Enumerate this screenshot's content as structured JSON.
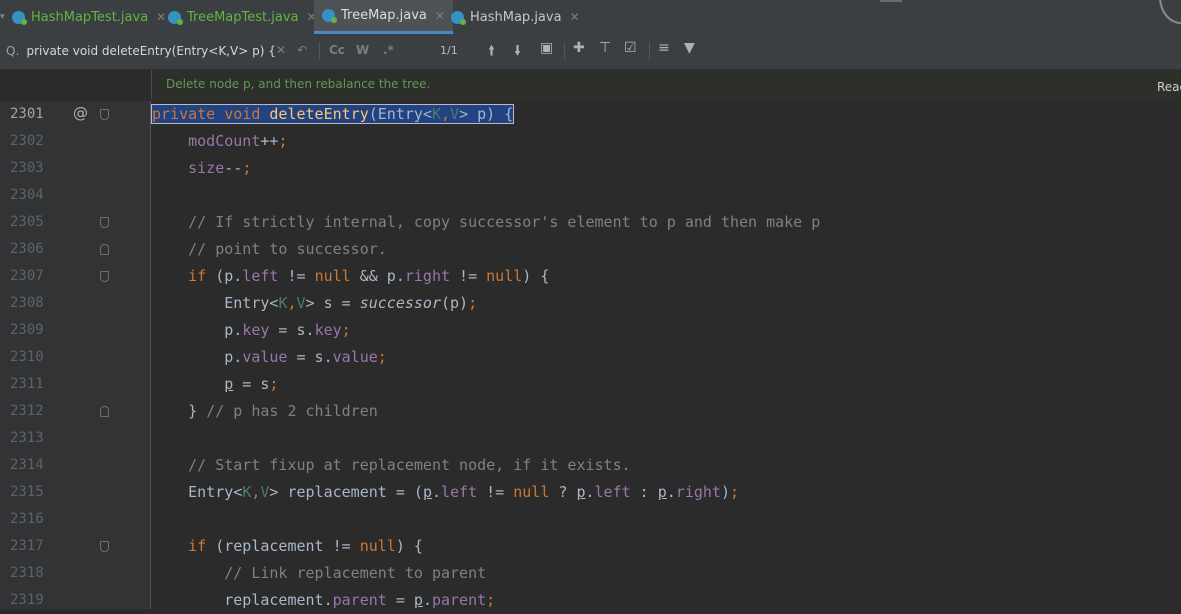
{
  "tabs": [
    {
      "label": "HashMapTest.java",
      "style": "green"
    },
    {
      "label": "TreeMapTest.java",
      "style": "green"
    },
    {
      "label": "TreeMap.java",
      "style": "active"
    },
    {
      "label": "HashMap.java",
      "style": "plain"
    }
  ],
  "search": {
    "query": "private void deleteEntry(Entry<K,V> p) {",
    "case_label": "Cc",
    "word_label": "W",
    "regex_label": ".*",
    "match_count": "1/1"
  },
  "doc_comment": "Delete node p, and then rebalance the tree.",
  "reader_mode_label": "Read",
  "colors": {
    "keyword": "#cc7832",
    "method": "#ffc66d",
    "field": "#9876aa",
    "type_param": "#507874",
    "comment": "#808080",
    "selection": "#214283"
  },
  "lines": [
    {
      "num": "2301",
      "marker": "@",
      "fold": "start",
      "current": true,
      "tokens": [
        {
          "t": "private void ",
          "c": "kw"
        },
        {
          "t": "deleteEntry",
          "c": "fn"
        },
        {
          "t": "(Entry<"
        },
        {
          "t": "K",
          "c": "tp"
        },
        {
          "t": ",",
          "c": "kw"
        },
        {
          "t": "V",
          "c": "tp"
        },
        {
          "t": "> p) {"
        }
      ],
      "selected": true
    },
    {
      "num": "2302",
      "tokens": [
        {
          "t": "    "
        },
        {
          "t": "modCount",
          "c": "fld"
        },
        {
          "t": "++"
        },
        {
          "t": ";",
          "c": "kw"
        }
      ]
    },
    {
      "num": "2303",
      "tokens": [
        {
          "t": "    "
        },
        {
          "t": "size",
          "c": "fld"
        },
        {
          "t": "--"
        },
        {
          "t": ";",
          "c": "kw"
        }
      ]
    },
    {
      "num": "2304",
      "tokens": []
    },
    {
      "num": "2305",
      "fold": "start",
      "tokens": [
        {
          "t": "    "
        },
        {
          "t": "// If strictly internal, copy successor's element to p and then make p",
          "c": "cm"
        }
      ]
    },
    {
      "num": "2306",
      "fold": "end",
      "tokens": [
        {
          "t": "    "
        },
        {
          "t": "// point to successor.",
          "c": "cm"
        }
      ]
    },
    {
      "num": "2307",
      "fold": "start",
      "tokens": [
        {
          "t": "    "
        },
        {
          "t": "if ",
          "c": "kw"
        },
        {
          "t": "(p."
        },
        {
          "t": "left",
          "c": "fld"
        },
        {
          "t": " != "
        },
        {
          "t": "null",
          "c": "kw"
        },
        {
          "t": " && p."
        },
        {
          "t": "right",
          "c": "fld"
        },
        {
          "t": " != "
        },
        {
          "t": "null",
          "c": "kw"
        },
        {
          "t": ") {"
        }
      ]
    },
    {
      "num": "2308",
      "tokens": [
        {
          "t": "        Entry<"
        },
        {
          "t": "K",
          "c": "tp"
        },
        {
          "t": ",",
          "c": "kw"
        },
        {
          "t": "V",
          "c": "tp"
        },
        {
          "t": "> s = "
        },
        {
          "t": "successor",
          "c": "it"
        },
        {
          "t": "(p)"
        },
        {
          "t": ";",
          "c": "kw"
        }
      ]
    },
    {
      "num": "2309",
      "tokens": [
        {
          "t": "        p."
        },
        {
          "t": "key",
          "c": "fld"
        },
        {
          "t": " = s."
        },
        {
          "t": "key",
          "c": "fld"
        },
        {
          "t": ";",
          "c": "kw"
        }
      ]
    },
    {
      "num": "2310",
      "tokens": [
        {
          "t": "        p."
        },
        {
          "t": "value",
          "c": "fld"
        },
        {
          "t": " = s."
        },
        {
          "t": "value",
          "c": "fld"
        },
        {
          "t": ";",
          "c": "kw"
        }
      ]
    },
    {
      "num": "2311",
      "tokens": [
        {
          "t": "        "
        },
        {
          "t": "p",
          "c": "ul"
        },
        {
          "t": " = s"
        },
        {
          "t": ";",
          "c": "kw"
        }
      ]
    },
    {
      "num": "2312",
      "fold": "end",
      "tokens": [
        {
          "t": "    } "
        },
        {
          "t": "// p has 2 children",
          "c": "cm"
        }
      ]
    },
    {
      "num": "2313",
      "tokens": []
    },
    {
      "num": "2314",
      "tokens": [
        {
          "t": "    "
        },
        {
          "t": "// Start fixup at replacement node, if it exists.",
          "c": "cm"
        }
      ]
    },
    {
      "num": "2315",
      "tokens": [
        {
          "t": "    Entry<"
        },
        {
          "t": "K",
          "c": "tp"
        },
        {
          "t": ",",
          "c": "kw"
        },
        {
          "t": "V",
          "c": "tp"
        },
        {
          "t": "> replacement = ("
        },
        {
          "t": "p",
          "c": "ul"
        },
        {
          "t": "."
        },
        {
          "t": "left",
          "c": "fld"
        },
        {
          "t": " != "
        },
        {
          "t": "null",
          "c": "kw"
        },
        {
          "t": " ? "
        },
        {
          "t": "p",
          "c": "ul"
        },
        {
          "t": "."
        },
        {
          "t": "left",
          "c": "fld"
        },
        {
          "t": " : "
        },
        {
          "t": "p",
          "c": "ul"
        },
        {
          "t": "."
        },
        {
          "t": "right",
          "c": "fld"
        },
        {
          "t": ")"
        },
        {
          "t": ";",
          "c": "kw"
        }
      ]
    },
    {
      "num": "2316",
      "tokens": []
    },
    {
      "num": "2317",
      "fold": "start",
      "tokens": [
        {
          "t": "    "
        },
        {
          "t": "if ",
          "c": "kw"
        },
        {
          "t": "(replacement != "
        },
        {
          "t": "null",
          "c": "kw"
        },
        {
          "t": ") {"
        }
      ]
    },
    {
      "num": "2318",
      "tokens": [
        {
          "t": "        "
        },
        {
          "t": "// Link replacement to parent",
          "c": "cm"
        }
      ]
    },
    {
      "num": "2319",
      "tokens": [
        {
          "t": "        replacement."
        },
        {
          "t": "parent",
          "c": "fld"
        },
        {
          "t": " = "
        },
        {
          "t": "p",
          "c": "ul"
        },
        {
          "t": "."
        },
        {
          "t": "parent",
          "c": "fld"
        },
        {
          "t": ";",
          "c": "kw"
        }
      ]
    }
  ]
}
